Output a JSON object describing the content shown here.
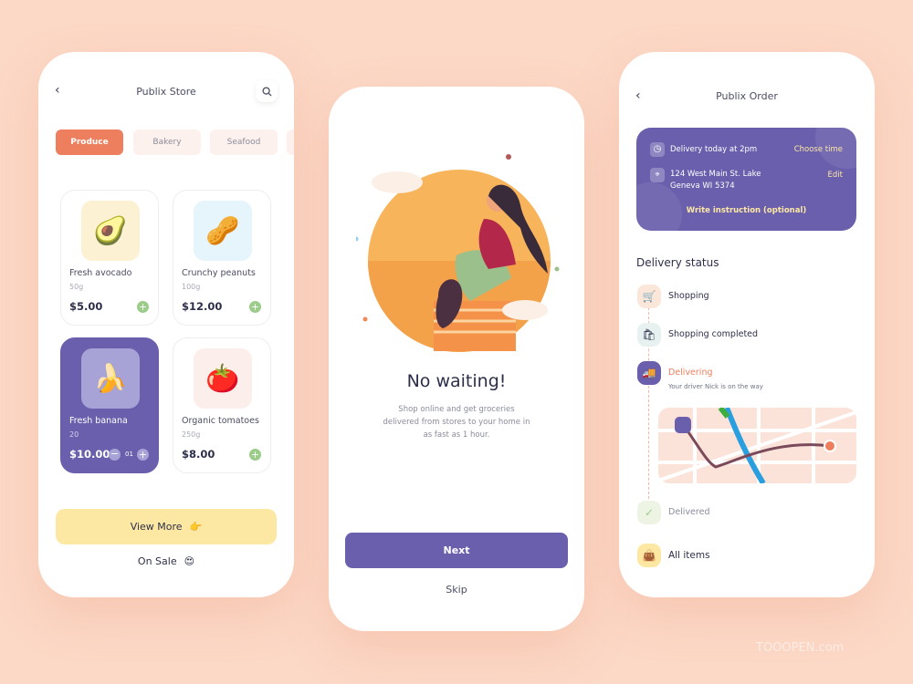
{
  "store": {
    "title": "Publix Store",
    "back_icon": "chevron-left-icon",
    "search_icon": "search-icon",
    "categories": [
      {
        "label": "Produce",
        "active": true
      },
      {
        "label": "Bakery"
      },
      {
        "label": "Seafood"
      },
      {
        "label": ""
      }
    ],
    "products": [
      {
        "name": "Fresh avocado",
        "weight": "50g",
        "price": "$5.00",
        "emoji": "🥑",
        "bg": "#fdf1d4"
      },
      {
        "name": "Crunchy peanuts",
        "weight": "100g",
        "price": "$12.00",
        "emoji": "🥜",
        "bg": "#e6f5fb"
      },
      {
        "name": "Fresh banana",
        "weight": "20",
        "price": "$10.00",
        "emoji": "🍌",
        "bg": "#a7a3d6",
        "selected": true,
        "qty": "01"
      },
      {
        "name": "Organic tomatoes",
        "weight": "250g",
        "price": "$8.00",
        "emoji": "🍅",
        "bg": "#fcefeb"
      }
    ],
    "view_more": "View More",
    "view_more_emoji": "👉",
    "on_sale": "On Sale",
    "on_sale_emoji": "😍"
  },
  "onboarding": {
    "heading": "No waiting!",
    "description": "Shop online and get groceries delivered from stores to your home in as fast as 1 hour.",
    "next": "Next",
    "skip": "Skip"
  },
  "order": {
    "title": "Publix Order",
    "delivery_time": "Delivery today at 2pm",
    "choose_time": "Choose time",
    "address": "124 West Main St. Lake Geneva WI 5374",
    "edit": "Edit",
    "instruction": "Write instruction (optional)",
    "status_heading": "Delivery status",
    "steps": [
      {
        "label": "Shopping"
      },
      {
        "label": "Shopping completed"
      },
      {
        "label": "Delivering",
        "sub": "Your driver Nick is on the way"
      },
      {
        "label": "Delivered"
      }
    ],
    "all_items": "All items"
  },
  "colors": {
    "accent": "#6a5fad",
    "orange": "#ee7f5e",
    "yellow": "#fde8a3",
    "green": "#9ccc8a",
    "background": "#fcd8c6"
  },
  "watermark": "TOOOPEN.com"
}
